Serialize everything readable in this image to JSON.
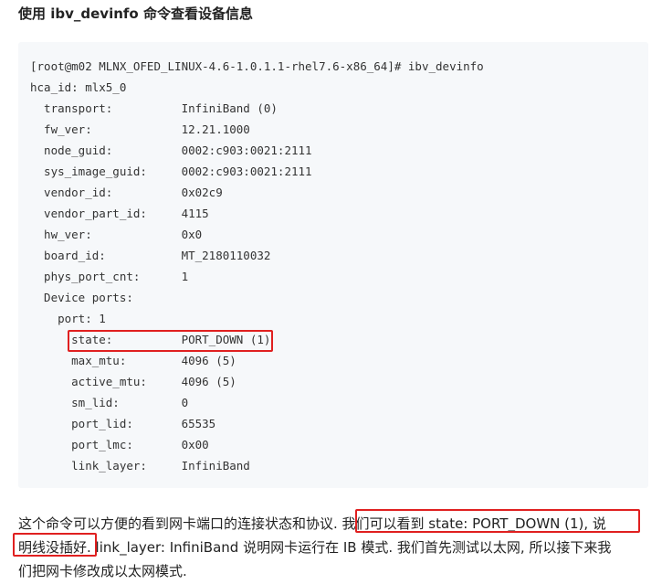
{
  "heading": "使用 ibv_devinfo 命令查看设备信息",
  "code_lines": [
    "[root@m02 MLNX_OFED_LINUX-4.6-1.0.1.1-rhel7.6-x86_64]# ibv_devinfo",
    "hca_id: mlx5_0",
    "  transport:          InfiniBand (0)",
    "  fw_ver:             12.21.1000",
    "  node_guid:          0002:c903:0021:2111",
    "  sys_image_guid:     0002:c903:0021:2111",
    "  vendor_id:          0x02c9",
    "  vendor_part_id:     4115",
    "  hw_ver:             0x0",
    "  board_id:           MT_2180110032",
    "  phys_port_cnt:      1",
    "  Device ports:",
    "    port: 1",
    "      state:          PORT_DOWN (1)",
    "      max_mtu:        4096 (5)",
    "      active_mtu:     4096 (5)",
    "      sm_lid:         0",
    "      port_lid:       65535",
    "      port_lmc:       0x00",
    "      link_layer:     InfiniBand"
  ],
  "paragraph_lines": [
    "这个命令可以方便的看到网卡端口的连接状态和协议. 我们可以看到 state: PORT_DOWN (1), 说",
    "明线没插好. link_layer: InfiniBand 说明网卡运行在 IB 模式. 我们首先测试以太网, 所以接下来我",
    "们把网卡修改成以太网模式."
  ],
  "highlight_color": "#e02020",
  "code_background": "#f6f8fa"
}
